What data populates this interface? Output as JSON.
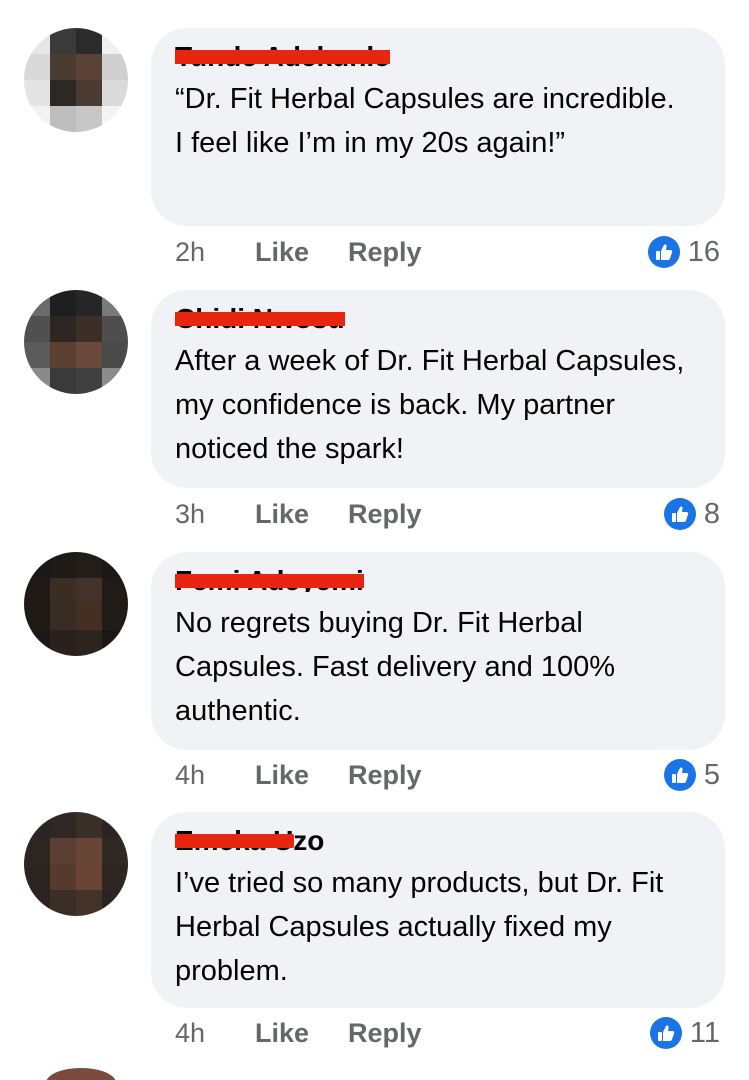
{
  "comments": [
    {
      "author": "Tunde Adekunle",
      "text": "“Dr. Fit Herbal Capsules are incredible. I feel like I’m in my 20s again!”",
      "time": "2h",
      "like_label": "Like",
      "reply_label": "Reply",
      "reaction_count": "16",
      "avatar_colors": [
        "#e6e6e6",
        "#3a3a3a",
        "#2b2b2b",
        "#f0f0f0",
        "#d9d9d9",
        "#4a3b33",
        "#5a4236",
        "#cfcfcf",
        "#e4e4e4",
        "#2d2824",
        "#4b3a31",
        "#dadada",
        "#f2f2f2",
        "#bdbdbd",
        "#c7c7c7",
        "#f4f4f4"
      ]
    },
    {
      "author": "Chidi Nwosu",
      "text": "After a week of Dr. Fit Herbal Capsules, my confidence is back. My partner noticed the spark!",
      "time": "3h",
      "like_label": "Like",
      "reply_label": "Reply",
      "reaction_count": "8",
      "avatar_colors": [
        "#6b6b6b",
        "#1f1f1f",
        "#262626",
        "#7a7a7a",
        "#505050",
        "#2e2622",
        "#3c2f29",
        "#4e4e4e",
        "#5a5a5a",
        "#5b4032",
        "#6a4a3a",
        "#4a4a4a",
        "#8a8a8a",
        "#3a3a3a",
        "#404040",
        "#8c8c8c"
      ]
    },
    {
      "author": "Femi Adeyemi",
      "text": "No regrets buying Dr. Fit Herbal Capsules. Fast delivery and 100% authentic.",
      "time": "4h",
      "like_label": "Like",
      "reply_label": "Reply",
      "reaction_count": "5",
      "avatar_colors": [
        "#1c1816",
        "#1e1a18",
        "#231d19",
        "#1c1816",
        "#1f1a17",
        "#3b2c24",
        "#43322a",
        "#211b18",
        "#201a17",
        "#3a2b23",
        "#452f25",
        "#221c18",
        "#1d1815",
        "#2a211c",
        "#2e241e",
        "#1c1715"
      ]
    },
    {
      "author": "Emeka Uzo",
      "text": "I’ve tried so many products, but Dr. Fit Herbal Capsules actually fixed my problem.",
      "time": "4h",
      "like_label": "Like",
      "reply_label": "Reply",
      "reaction_count": "11",
      "avatar_colors": [
        "#2a2422",
        "#2f2724",
        "#3a2e28",
        "#2a2422",
        "#2d2522",
        "#5a3f32",
        "#674636",
        "#302824",
        "#2c2421",
        "#553a2d",
        "#6a4536",
        "#2f2623",
        "#2a2320",
        "#3b2e27",
        "#42322a",
        "#2a2320"
      ]
    }
  ]
}
